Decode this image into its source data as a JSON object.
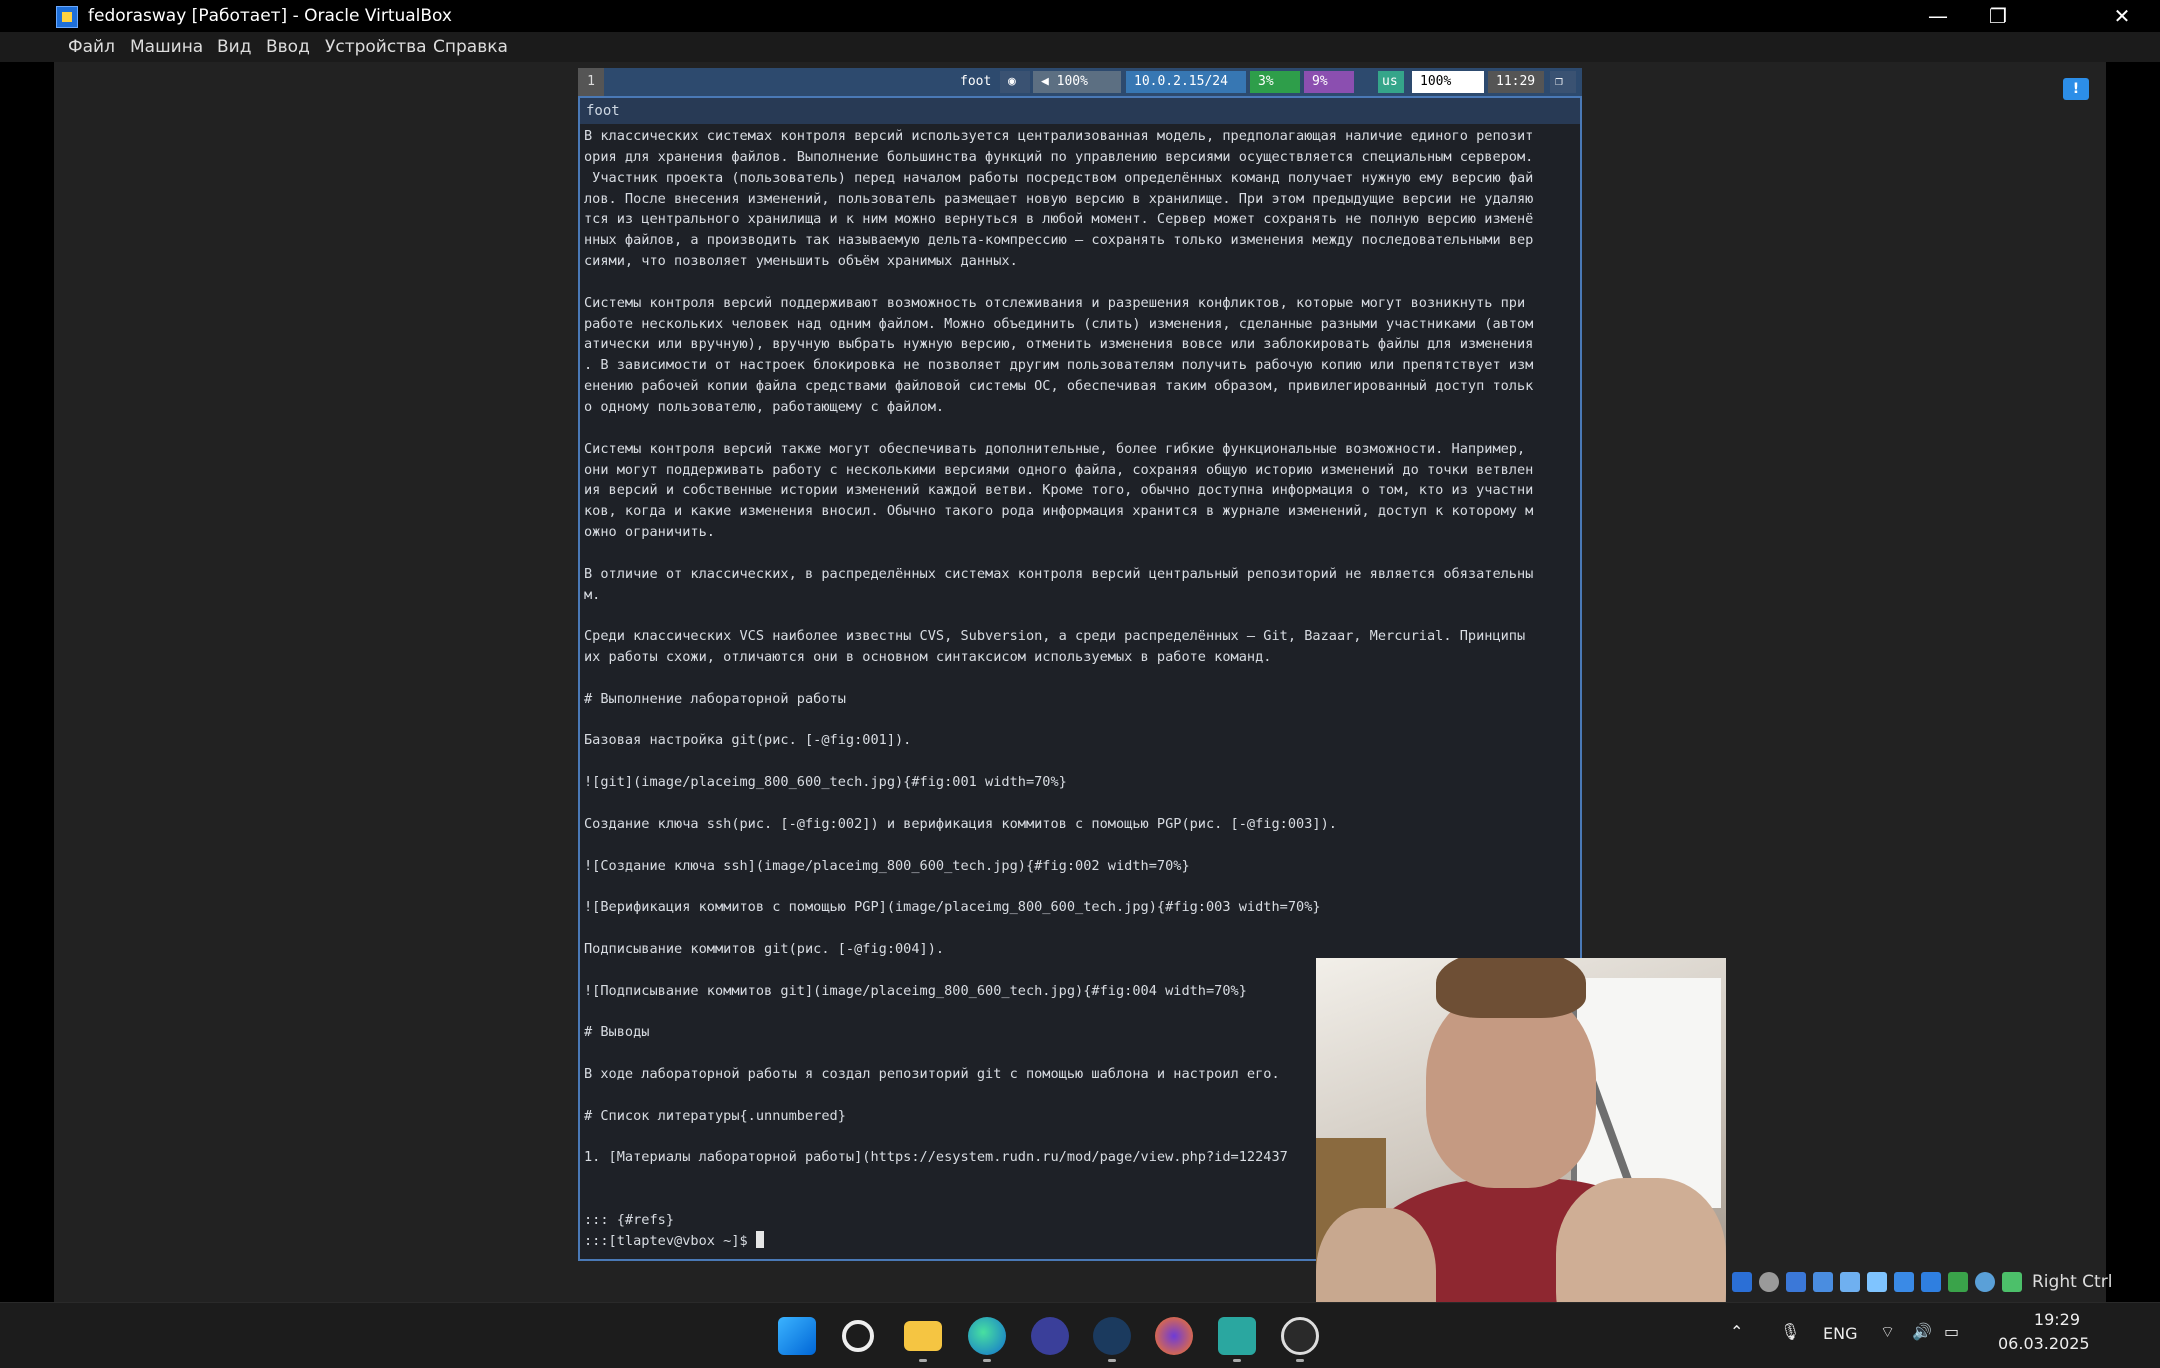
{
  "window": {
    "title": "fedorasway [Работает] - Oracle VirtualBox",
    "controls": {
      "minimize": "—",
      "maximize": "❐",
      "close": "✕"
    }
  },
  "menubar": {
    "items": [
      "Файл",
      "Машина",
      "Вид",
      "Ввод",
      "Устройства",
      "Справка"
    ]
  },
  "sway_bar": {
    "workspace": "1",
    "app_title": "foot",
    "volume": "100%",
    "network": "10.0.2.15/24",
    "cpu": "3%",
    "memory": "9%",
    "layout": "us",
    "battery": "100%",
    "time": "11:29",
    "colors": {
      "bar": "#2d4a6e",
      "cpu": "#2e9e4a",
      "memory": "#8b4fb0",
      "layout": "#35a58a",
      "battery": "#ffffff",
      "time": "#555555",
      "network": "#3777b3",
      "volume": "#5c6f82"
    }
  },
  "terminal": {
    "title": "foot",
    "lines": [
      "В классических системах контроля версий используется централизованная модель, предполагающая наличие единого репозит",
      "ория для хранения файлов. Выполнение большинства функций по управлению версиями осуществляется специальным сервером.",
      " Участник проекта (пользователь) перед началом работы посредством определённых команд получает нужную ему версию фай",
      "лов. После внесения изменений, пользователь размещает новую версию в хранилище. При этом предыдущие версии не удаляю",
      "тся из центрального хранилища и к ним можно вернуться в любой момент. Сервер может сохранять не полную версию изменё",
      "нных файлов, а производить так называемую дельта-компрессию — сохранять только изменения между последовательными вер",
      "сиями, что позволяет уменьшить объём хранимых данных.",
      "",
      "Системы контроля версий поддерживают возможность отслеживания и разрешения конфликтов, которые могут возникнуть при ",
      "работе нескольких человек над одним файлом. Можно объединить (слить) изменения, сделанные разными участниками (автом",
      "атически или вручную), вручную выбрать нужную версию, отменить изменения вовсе или заблокировать файлы для изменения",
      ". В зависимости от настроек блокировка не позволяет другим пользователям получить рабочую копию или препятствует изм",
      "енению рабочей копии файла средствами файловой системы ОС, обеспечивая таким образом, привилегированный доступ тольк",
      "о одному пользователю, работающему с файлом.",
      "",
      "Системы контроля версий также могут обеспечивать дополнительные, более гибкие функциональные возможности. Например,",
      "они могут поддерживать работу с несколькими версиями одного файла, сохраняя общую историю изменений до точки ветвлен",
      "ия версий и собственные истории изменений каждой ветви. Кроме того, обычно доступна информация о том, кто из участни",
      "ков, когда и какие изменения вносил. Обычно такого рода информация хранится в журнале изменений, доступ к которому м",
      "ожно ограничить.",
      "",
      "В отличие от классических, в распределённых системах контроля версий центральный репозиторий не является обязательны",
      "м.",
      "",
      "Среди классических VCS наиболее известны CVS, Subversion, а среди распределённых — Git, Bazaar, Mercurial. Принципы",
      "их работы схожи, отличаются они в основном синтаксисом используемых в работе команд.",
      "",
      "# Выполнение лабораторной работы",
      "",
      "Базовая настройка git(рис. [-@fig:001]).",
      "",
      "![git](image/placeimg_800_600_tech.jpg){#fig:001 width=70%}",
      "",
      "Создание ключа ssh(рис. [-@fig:002]) и верификация коммитов с помощью PGP(рис. [-@fig:003]).",
      "",
      "![Создание ключа ssh](image/placeimg_800_600_tech.jpg){#fig:002 width=70%}",
      "",
      "![Верификация коммитов с помощью PGP](image/placeimg_800_600_tech.jpg){#fig:003 width=70%}",
      "",
      "Подписывание коммитов git(рис. [-@fig:004]).",
      "",
      "![Подписывание коммитов git](image/placeimg_800_600_tech.jpg){#fig:004 width=70%}",
      "",
      "# Выводы",
      "",
      "В ходе лабораторной работы я создал репозиторий git с помощью шаблона и настроил его.",
      "",
      "# Список литературы{.unnumbered}",
      "",
      "1. [Материалы лабораторной работы](https://esystem.rudn.ru/mod/page/view.php?id=122437",
      "",
      "",
      "::: {#refs}"
    ],
    "prompt": ":::[tlaptev@vbox ~]$ "
  },
  "vbox_status": {
    "host_key": "Right Ctrl"
  },
  "taskbar": {
    "apps": [
      "windows-start-icon",
      "search-icon",
      "file-explorer-icon",
      "edge-icon",
      "dev-app-icon",
      "steam-icon",
      "firefox-icon",
      "visual-studio-icon",
      "obs-icon"
    ]
  },
  "tray": {
    "language": "ENG",
    "time": "19:29",
    "date": "06.03.2025"
  }
}
